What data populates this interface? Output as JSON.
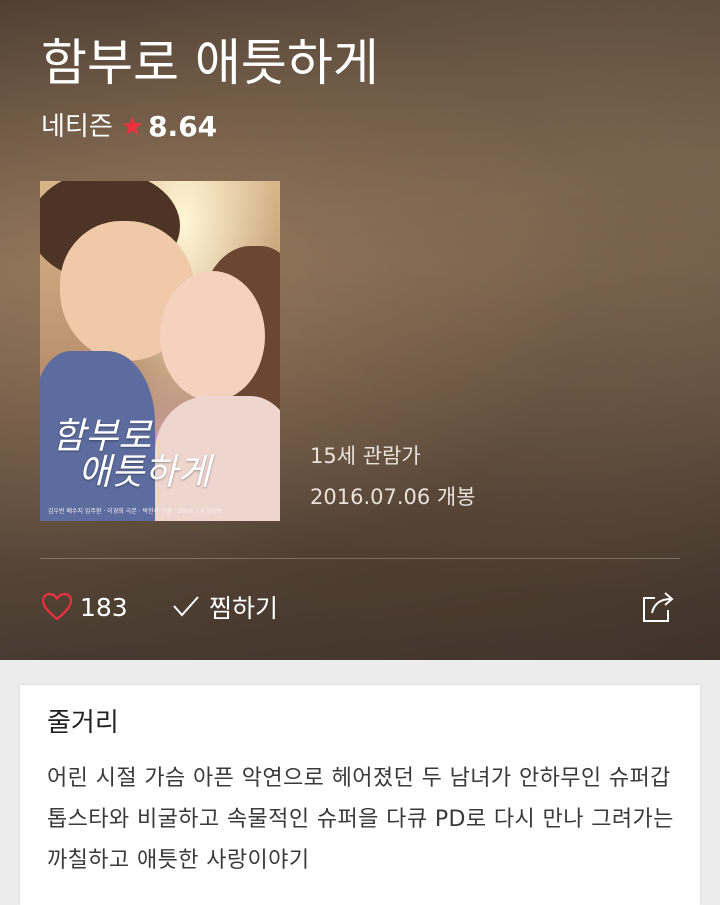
{
  "movie": {
    "title": "함부로 애틋하게",
    "rating_label": "네티즌",
    "rating_score": "8.64",
    "age_grade": "15세 관람가",
    "release": "2016.07.06 개봉"
  },
  "poster": {
    "title_line1": "함부로",
    "title_line2": "애틋하게",
    "credits": "김우빈 배수지 임주환 · 이경희 극본 · 박현석 연출 · 2016.7.6 첫방송"
  },
  "actions": {
    "like_count": "183",
    "wish_label": "찜하기"
  },
  "synopsis": {
    "heading": "줄거리",
    "text": "어린 시절 가슴 아픈 악연으로 헤어졌던 두 남녀가 안하무인 슈퍼갑 톱스타와 비굴하고 속물적인 슈퍼을 다큐 PD로 다시 만나 그려가는 까칠하고 애틋한 사랑이야기"
  },
  "colors": {
    "star": "#f0313d",
    "heart": "#f0313d"
  },
  "icons": [
    "star-icon",
    "heart-icon",
    "check-icon",
    "share-icon"
  ]
}
